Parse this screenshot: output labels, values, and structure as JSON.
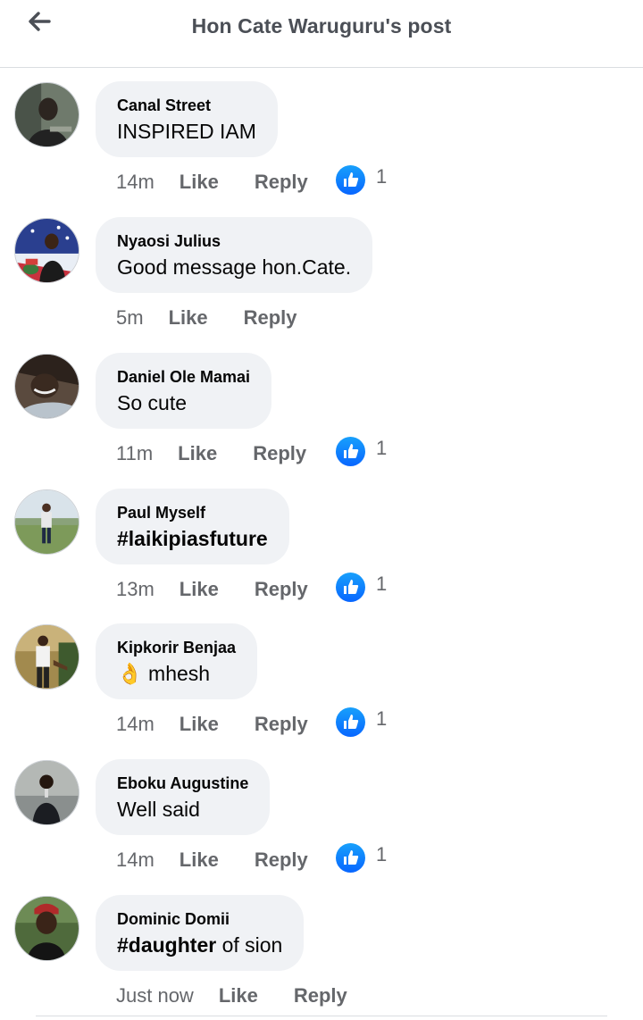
{
  "header": {
    "title": "Hon Cate Waruguru's post",
    "back_icon": "arrow-left-icon"
  },
  "colors": {
    "bubble": "#f0f2f5",
    "secondary_text": "#65676b",
    "like_blue": "#1877f2",
    "header_text": "#4b4f56"
  },
  "comments": [
    {
      "author": "Canal Street",
      "text": "INSPIRED IAM",
      "time": "14m",
      "like": "Like",
      "reply": "Reply",
      "reactions": "1"
    },
    {
      "author": "Nyaosi Julius",
      "text": "Good message hon.Cate.",
      "time": "5m",
      "like": "Like",
      "reply": "Reply",
      "reactions": ""
    },
    {
      "author": "Daniel Ole Mamai",
      "text": "So cute",
      "time": "11m",
      "like": "Like",
      "reply": "Reply",
      "reactions": "1"
    },
    {
      "author": "Paul Myself",
      "text": "#laikipiasfuture",
      "time": "13m",
      "like": "Like",
      "reply": "Reply",
      "reactions": "1"
    },
    {
      "author": "Kipkorir Benjaa",
      "emoji": "👌",
      "text": "mhesh",
      "time": "14m",
      "like": "Like",
      "reply": "Reply",
      "reactions": "1"
    },
    {
      "author": "Eboku Augustine",
      "text": "Well said",
      "time": "14m",
      "like": "Like",
      "reply": "Reply",
      "reactions": "1"
    },
    {
      "author": "Dominic Domii",
      "hashtag": "#daughter",
      "text": "of sion",
      "time": "Just now",
      "like": "Like",
      "reply": "Reply",
      "reactions": ""
    }
  ]
}
